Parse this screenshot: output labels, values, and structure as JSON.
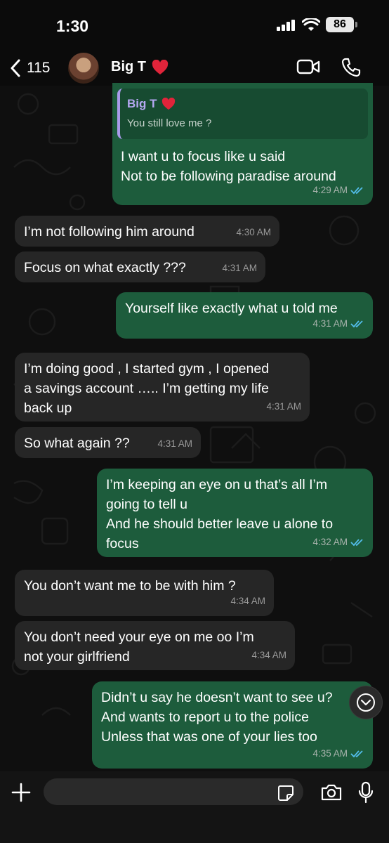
{
  "status_bar": {
    "time": "1:30",
    "battery": "86"
  },
  "header": {
    "back_count": "115",
    "contact_name": "Big T"
  },
  "quoted": {
    "name": "Big T",
    "text": "You still love me ?"
  },
  "messages": [
    {
      "dir": "out",
      "text": "I want u  to focus like u said\nNot to be following paradise around",
      "time": "4:29 AM",
      "ticks": "read"
    },
    {
      "dir": "in",
      "text": "I’m not following him around",
      "time": "4:30 AM"
    },
    {
      "dir": "in",
      "text": "Focus on what exactly ???",
      "time": "4:31 AM"
    },
    {
      "dir": "out",
      "text": "Yourself like exactly what u told me",
      "time": "4:31 AM",
      "ticks": "read"
    },
    {
      "dir": "in",
      "text": "I’m doing good , I started gym , I opened\na savings account ….. I’m getting my life\nback up",
      "time": "4:31 AM"
    },
    {
      "dir": "in",
      "text": "So what again ??",
      "time": "4:31 AM"
    },
    {
      "dir": "out",
      "text": "I’m keeping an eye on u that’s all I’m\ngoing to tell u\nAnd he should better leave u alone to\nfocus",
      "time": "4:32 AM",
      "ticks": "read"
    },
    {
      "dir": "in",
      "text": "You don’t want me to be with him ?",
      "time": "4:34 AM"
    },
    {
      "dir": "in",
      "text": "You don’t need your eye on me oo I’m\nnot your girlfriend",
      "time": "4:34 AM"
    },
    {
      "dir": "out",
      "text": "Didn’t u say he doesn’t want to see u?\nAnd wants to report u to the police\nUnless that was one of your lies too",
      "time": "4:35 AM",
      "ticks": "read"
    }
  ],
  "composer": {
    "placeholder": ""
  },
  "colors": {
    "outgoing": "#1d5c3c",
    "incoming": "#262626",
    "read_tick": "#53bdeb",
    "quote_bar": "#a99bea"
  },
  "icons": [
    "back-chevron-icon",
    "heart-emoji-icon",
    "video-call-icon",
    "phone-icon",
    "plus-icon",
    "sticker-icon",
    "camera-icon",
    "microphone-icon",
    "scroll-down-icon",
    "read-receipt-icon"
  ]
}
